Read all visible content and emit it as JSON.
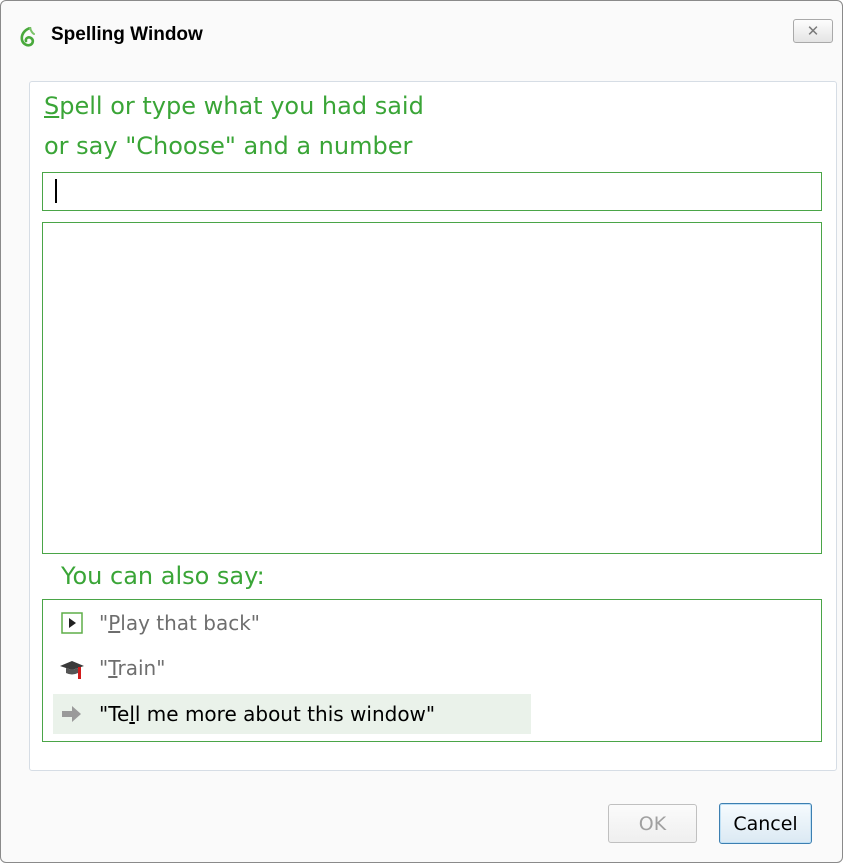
{
  "window": {
    "title": "Spelling Window",
    "close_glyph": "✕"
  },
  "prompt": {
    "line1_underlined": "S",
    "line1_rest": "pell or type what you had said",
    "line2": "or say \"Choose\" and a number"
  },
  "spell_input": {
    "value": ""
  },
  "choices": [],
  "also_say_label": "You can also say:",
  "commands": [
    {
      "icon": "play-icon",
      "before": "\"",
      "underlined": "P",
      "after": "lay that back\""
    },
    {
      "icon": "graduation-cap-icon",
      "before": "\"",
      "underlined": "T",
      "after": "rain\""
    },
    {
      "icon": "arrow-right-icon",
      "before": "\"Te",
      "underlined": "l",
      "after": "l me more about this window\""
    }
  ],
  "buttons": {
    "ok_label": "OK",
    "cancel_label": "Cancel"
  },
  "colors": {
    "accent_green": "#3aa537",
    "border_green": "#4aa547",
    "selected_row": "#eaf2ea"
  }
}
